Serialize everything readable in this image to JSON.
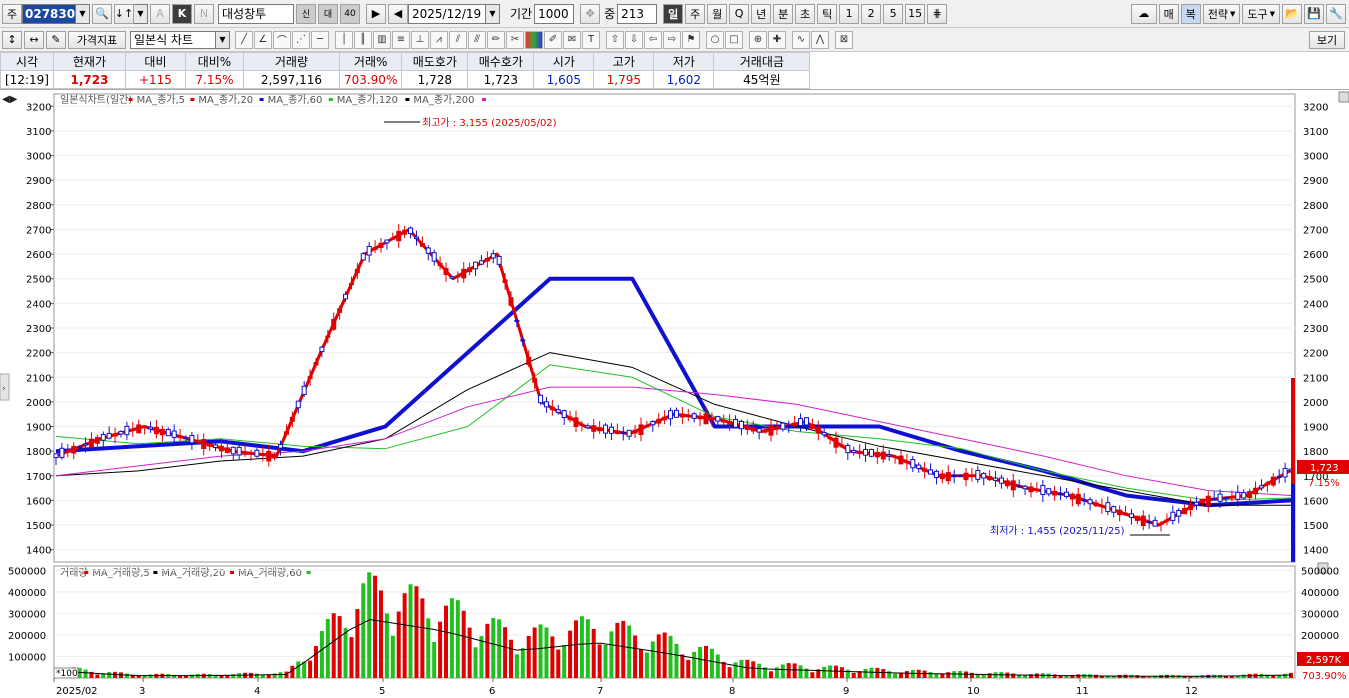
{
  "toolbar": {
    "type_label": "주",
    "stock_code": "027830",
    "stock_name": "대성창투",
    "date": "2025/12/19",
    "period_label": "기간",
    "period_value": "1000",
    "count_label": "중",
    "count_value": "213",
    "k_label": "K",
    "a_label": "A",
    "n_label": "N",
    "badges": [
      "신",
      "대",
      "40"
    ],
    "timeframes": [
      "일",
      "주",
      "월",
      "Q",
      "년",
      "분",
      "초",
      "틱",
      "1",
      "2",
      "5",
      "15"
    ],
    "right_buttons": [
      "매",
      "복",
      "전략",
      "도구"
    ],
    "price_indicator": "가격지표",
    "chart_type": "일본식 차트",
    "view_label": "보기"
  },
  "quote": {
    "headers": [
      "시각",
      "현재가",
      "대비",
      "대비%",
      "거래량",
      "거래%",
      "매도호가",
      "매수호가",
      "시가",
      "고가",
      "저가",
      "거래대금"
    ],
    "values": [
      "[12:19]",
      "1,723",
      "+115",
      "7.15%",
      "2,597,116",
      "703.90%",
      "1,728",
      "1,723",
      "1,605",
      "1,795",
      "1,602",
      "45억원"
    ]
  },
  "price_panel": {
    "legend": [
      "일본식차트(일간)",
      "MA_종가,5",
      "MA_종가,20",
      "MA_종가,60",
      "MA_종가,120",
      "MA_종가,200"
    ],
    "legend_colors": [
      "#333333",
      "#e00000",
      "#e00000",
      "#1010d0",
      "#20c020",
      "#000000",
      "#d020d0"
    ],
    "y_ticks": [
      "3200",
      "3100",
      "3000",
      "2900",
      "2800",
      "2700",
      "2600",
      "2500",
      "2400",
      "2300",
      "2200",
      "2100",
      "2000",
      "1900",
      "1800",
      "1700",
      "1600",
      "1500",
      "1400"
    ],
    "high_annotation": "최고가 : 3,155 (2025/05/02)",
    "low_annotation": "최저가 : 1,455 (2025/11/25)",
    "current_price_tag": "1,723",
    "current_pct_tag": "7.15%"
  },
  "volume_panel": {
    "legend": [
      "거래량",
      "MA_거래량,5",
      "MA_거래량,20",
      "MA_거래량,60"
    ],
    "legend_colors": [
      "#333333",
      "#e00000",
      "#000000",
      "#e00000",
      "#20c020"
    ],
    "y_ticks": [
      "500000",
      "400000",
      "300000",
      "200000",
      "100000"
    ],
    "scale_label": "*100",
    "current_volume_tag": "2,597K",
    "current_pct_tag": "703.90%"
  },
  "x_axis": {
    "labels": [
      "2025/02",
      "3",
      "4",
      "5",
      "6",
      "7",
      "8",
      "9",
      "10",
      "11",
      "12"
    ]
  },
  "chart_data": {
    "type": "line",
    "symbol": "027830",
    "series": [
      {
        "name": "MA_종가,20",
        "values": [
          1800,
          1820,
          1840,
          1800,
          1900,
          2200,
          2500,
          2500,
          1900,
          1900,
          1900,
          1800,
          1720,
          1620,
          1580,
          1600
        ]
      },
      {
        "name": "MA_종가,60",
        "values": [
          1860,
          1830,
          1850,
          1820,
          1810,
          1900,
          2150,
          2100,
          1940,
          1880,
          1850,
          1810,
          1720,
          1650,
          1600,
          1610
        ]
      },
      {
        "name": "MA_종가,120",
        "values": [
          1700,
          1720,
          1760,
          1780,
          1850,
          2050,
          2200,
          2140,
          1990,
          1900,
          1820,
          1760,
          1700,
          1640,
          1580,
          1580
        ]
      },
      {
        "name": "MA_종가,200",
        "values": [
          1700,
          1740,
          1780,
          1800,
          1850,
          1980,
          2060,
          2060,
          2030,
          1990,
          1920,
          1850,
          1780,
          1700,
          1640,
          1620
        ]
      }
    ],
    "close_path": [
      1780,
      1850,
      1900,
      1850,
      1800,
      1780,
      2200,
      2600,
      2700,
      2500,
      2600,
      2000,
      1900,
      1870,
      1950,
      1930,
      1880,
      1920,
      1800,
      1780,
      1700,
      1700,
      1650,
      1620,
      1560,
      1500,
      1600,
      1620,
      1723
    ],
    "ylim": [
      1350,
      3250
    ],
    "volume_ylim": [
      0,
      520000
    ],
    "volume_bars": [
      60000,
      20000,
      20000,
      30000,
      500000,
      400000,
      230000,
      300000,
      200000,
      80000,
      60000,
      40000,
      30000,
      20000,
      15000,
      15000,
      25000
    ]
  }
}
